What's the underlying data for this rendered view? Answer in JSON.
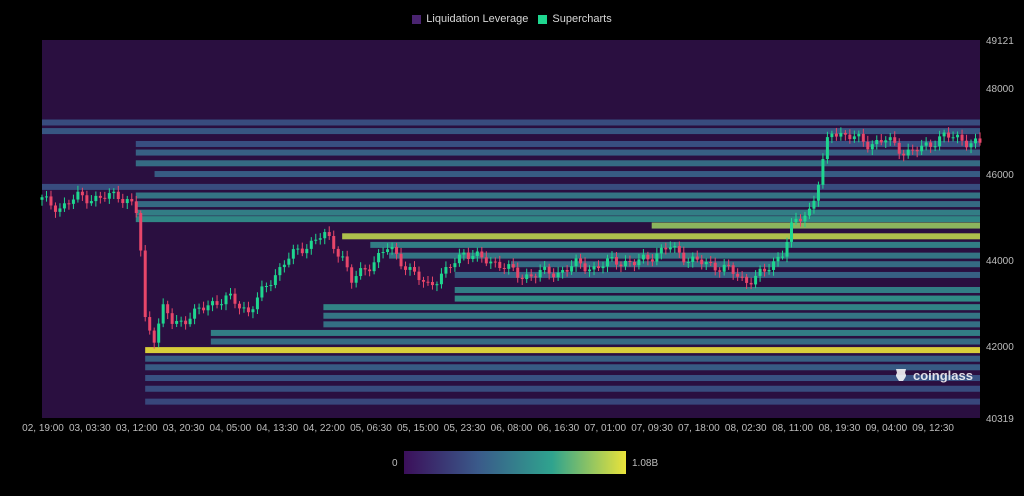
{
  "legend": [
    {
      "label": "Liquidation Leverage",
      "color": "#4a2470"
    },
    {
      "label": "Supercharts",
      "color": "#1fd68f"
    }
  ],
  "colorbar": {
    "min_label": "0",
    "max_label": "1.08B",
    "colors": [
      "#3b0f5a",
      "#3a5a8a",
      "#2fa38e",
      "#eae33a"
    ]
  },
  "watermark": "coinglass",
  "colors": {
    "background": "#000000",
    "heatmap_base": "#2a0f40",
    "up": "#1fd68f",
    "down": "#e8466a",
    "hot": "#eae33a"
  },
  "chart_data": {
    "type": "heatmap",
    "title": "",
    "ylim": [
      40319,
      49121
    ],
    "y_ticks": [
      "49121",
      "48000",
      "46000",
      "44000",
      "42000",
      "40319"
    ],
    "x_ticks": [
      "02, 19:00",
      "03, 03:30",
      "03, 12:00",
      "03, 20:30",
      "04, 05:00",
      "04, 13:30",
      "04, 22:00",
      "05, 06:30",
      "05, 15:00",
      "05, 23:30",
      "06, 08:00",
      "06, 16:30",
      "07, 01:00",
      "07, 09:30",
      "07, 18:00",
      "08, 02:30",
      "08, 11:00",
      "08, 19:30",
      "09, 04:00",
      "09, 12:30"
    ],
    "liquidation_levels": [
      {
        "price": 47200,
        "start": 0.0,
        "intensity": 0.3
      },
      {
        "price": 47000,
        "start": 0.0,
        "intensity": 0.35
      },
      {
        "price": 46700,
        "start": 0.1,
        "intensity": 0.32
      },
      {
        "price": 46500,
        "start": 0.1,
        "intensity": 0.4
      },
      {
        "price": 46250,
        "start": 0.1,
        "intensity": 0.45
      },
      {
        "price": 46000,
        "start": 0.12,
        "intensity": 0.38
      },
      {
        "price": 45700,
        "start": 0.0,
        "intensity": 0.3
      },
      {
        "price": 45500,
        "start": 0.1,
        "intensity": 0.5
      },
      {
        "price": 45300,
        "start": 0.1,
        "intensity": 0.45
      },
      {
        "price": 45100,
        "start": 0.1,
        "intensity": 0.55
      },
      {
        "price": 44950,
        "start": 0.1,
        "intensity": 0.6
      },
      {
        "price": 44800,
        "start": 0.65,
        "intensity": 0.85
      },
      {
        "price": 44550,
        "start": 0.32,
        "intensity": 0.92
      },
      {
        "price": 44350,
        "start": 0.35,
        "intensity": 0.55
      },
      {
        "price": 44100,
        "start": 0.37,
        "intensity": 0.5
      },
      {
        "price": 43900,
        "start": 0.5,
        "intensity": 0.45
      },
      {
        "price": 43650,
        "start": 0.44,
        "intensity": 0.4
      },
      {
        "price": 43300,
        "start": 0.44,
        "intensity": 0.55
      },
      {
        "price": 43100,
        "start": 0.44,
        "intensity": 0.62
      },
      {
        "price": 42900,
        "start": 0.3,
        "intensity": 0.58
      },
      {
        "price": 42700,
        "start": 0.3,
        "intensity": 0.5
      },
      {
        "price": 42500,
        "start": 0.3,
        "intensity": 0.48
      },
      {
        "price": 42300,
        "start": 0.18,
        "intensity": 0.55
      },
      {
        "price": 42100,
        "start": 0.18,
        "intensity": 0.45
      },
      {
        "price": 41900,
        "start": 0.11,
        "intensity": 1.0
      },
      {
        "price": 41700,
        "start": 0.11,
        "intensity": 0.4
      },
      {
        "price": 41500,
        "start": 0.11,
        "intensity": 0.38
      },
      {
        "price": 41250,
        "start": 0.11,
        "intensity": 0.33
      },
      {
        "price": 41000,
        "start": 0.11,
        "intensity": 0.3
      },
      {
        "price": 40700,
        "start": 0.11,
        "intensity": 0.28
      }
    ],
    "price_path": [
      {
        "x": 0.0,
        "y": 45400
      },
      {
        "x": 0.02,
        "y": 45200
      },
      {
        "x": 0.04,
        "y": 45500
      },
      {
        "x": 0.06,
        "y": 45400
      },
      {
        "x": 0.08,
        "y": 45550
      },
      {
        "x": 0.1,
        "y": 45200
      },
      {
        "x": 0.105,
        "y": 44300
      },
      {
        "x": 0.11,
        "y": 42600
      },
      {
        "x": 0.12,
        "y": 42200
      },
      {
        "x": 0.13,
        "y": 42900
      },
      {
        "x": 0.14,
        "y": 42500
      },
      {
        "x": 0.16,
        "y": 42700
      },
      {
        "x": 0.18,
        "y": 43000
      },
      {
        "x": 0.2,
        "y": 43100
      },
      {
        "x": 0.22,
        "y": 42800
      },
      {
        "x": 0.24,
        "y": 43400
      },
      {
        "x": 0.26,
        "y": 44000
      },
      {
        "x": 0.28,
        "y": 44300
      },
      {
        "x": 0.3,
        "y": 44600
      },
      {
        "x": 0.32,
        "y": 44100
      },
      {
        "x": 0.33,
        "y": 43500
      },
      {
        "x": 0.35,
        "y": 43900
      },
      {
        "x": 0.37,
        "y": 44300
      },
      {
        "x": 0.39,
        "y": 43800
      },
      {
        "x": 0.41,
        "y": 43400
      },
      {
        "x": 0.43,
        "y": 43700
      },
      {
        "x": 0.45,
        "y": 44200
      },
      {
        "x": 0.47,
        "y": 44000
      },
      {
        "x": 0.49,
        "y": 43900
      },
      {
        "x": 0.51,
        "y": 43600
      },
      {
        "x": 0.53,
        "y": 43700
      },
      {
        "x": 0.55,
        "y": 43700
      },
      {
        "x": 0.57,
        "y": 43900
      },
      {
        "x": 0.59,
        "y": 43800
      },
      {
        "x": 0.61,
        "y": 44000
      },
      {
        "x": 0.63,
        "y": 43900
      },
      {
        "x": 0.65,
        "y": 44100
      },
      {
        "x": 0.67,
        "y": 44300
      },
      {
        "x": 0.69,
        "y": 44000
      },
      {
        "x": 0.71,
        "y": 43900
      },
      {
        "x": 0.73,
        "y": 43800
      },
      {
        "x": 0.75,
        "y": 43500
      },
      {
        "x": 0.77,
        "y": 43700
      },
      {
        "x": 0.79,
        "y": 44200
      },
      {
        "x": 0.8,
        "y": 44800
      },
      {
        "x": 0.82,
        "y": 45200
      },
      {
        "x": 0.83,
        "y": 46000
      },
      {
        "x": 0.84,
        "y": 47000
      },
      {
        "x": 0.86,
        "y": 46900
      },
      {
        "x": 0.88,
        "y": 46700
      },
      {
        "x": 0.9,
        "y": 46800
      },
      {
        "x": 0.92,
        "y": 46500
      },
      {
        "x": 0.94,
        "y": 46600
      },
      {
        "x": 0.96,
        "y": 46900
      },
      {
        "x": 1.0,
        "y": 46700
      }
    ]
  }
}
